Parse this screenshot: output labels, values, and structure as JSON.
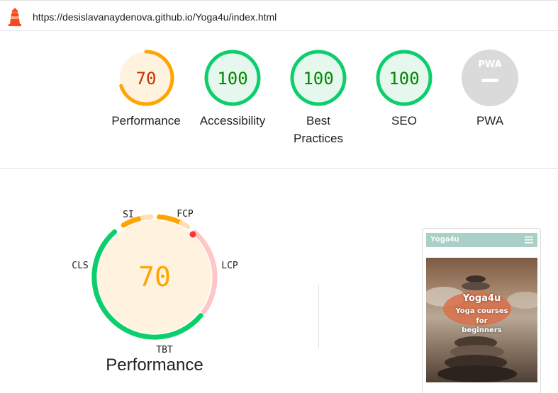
{
  "report": {
    "url": "https://desislavanaydenova.github.io/Yoga4u/index.html"
  },
  "categories": [
    {
      "label": "Performance",
      "score": "70",
      "score_fraction": 0.7,
      "color": "#ffa400",
      "fill": "#fff3e0",
      "text_color": "#c33300"
    },
    {
      "label": "Accessibility",
      "score": "100",
      "score_fraction": 1.0,
      "color": "#0cce6b",
      "fill": "#e6f8ee",
      "text_color": "#008800"
    },
    {
      "label": "Best Practices",
      "label_line1": "Best",
      "label_line2": "Practices",
      "score": "100",
      "score_fraction": 1.0,
      "color": "#0cce6b",
      "fill": "#e6f8ee",
      "text_color": "#008800"
    },
    {
      "label": "SEO",
      "score": "100",
      "score_fraction": 1.0,
      "color": "#0cce6b",
      "fill": "#e6f8ee",
      "text_color": "#008800"
    },
    {
      "label": "PWA",
      "badge": "PWA",
      "color": "#dadada"
    }
  ],
  "performance": {
    "score": "70",
    "title": "Performance",
    "metrics": {
      "si": "SI",
      "fcp": "FCP",
      "lcp": "LCP",
      "tbt": "TBT",
      "cls": "CLS"
    }
  },
  "screenshot": {
    "brand": "Yoga4u",
    "hero_title": "Yoga4u",
    "hero_line1": "Yoga courses",
    "hero_line2": "for",
    "hero_line3": "beginners"
  }
}
